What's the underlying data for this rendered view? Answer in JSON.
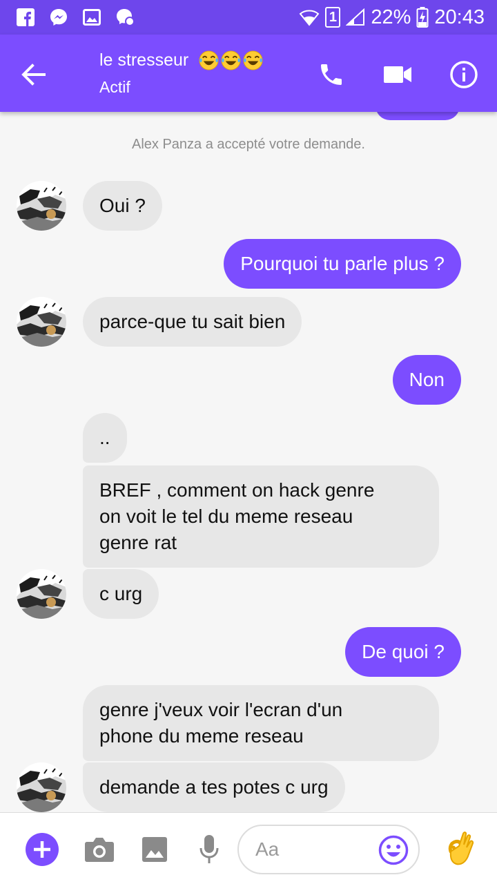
{
  "status_bar": {
    "left_icons": [
      "facebook-icon",
      "messenger-icon",
      "gallery-icon",
      "messenger-bubble-icon"
    ],
    "sim": "1",
    "battery": "22%",
    "time": "20:43"
  },
  "header": {
    "contact_name": "le stresseur",
    "emoji_count": 3,
    "status": "Actif",
    "actions": [
      "phone-icon",
      "video-icon",
      "info-icon"
    ]
  },
  "conversation": {
    "system_message": "Alex Panza a accepté votre demande.",
    "messages": [
      {
        "from": "them",
        "text": "Oui ?"
      },
      {
        "from": "me",
        "text": "Pourquoi tu parle plus ?"
      },
      {
        "from": "them",
        "text": "parce-que tu sait bien"
      },
      {
        "from": "me",
        "text": "Non"
      },
      {
        "from": "them",
        "text": ".."
      },
      {
        "from": "them",
        "lines": [
          "BREF , comment on hack genre",
          "on voit le tel du meme reseau",
          "genre rat"
        ]
      },
      {
        "from": "them",
        "text": "c urg"
      },
      {
        "from": "me",
        "text": "De quoi ?"
      },
      {
        "from": "them",
        "lines": [
          "genre j'veux voir l'ecran d'un",
          "phone du meme reseau"
        ]
      },
      {
        "from": "them",
        "text": "demande a tes potes c urg"
      }
    ]
  },
  "composer": {
    "placeholder": "Aa",
    "buttons": [
      "plus-icon",
      "camera-icon",
      "image-icon",
      "microphone-icon",
      "smiley-icon",
      "ok-hand-icon"
    ]
  },
  "colors": {
    "accent": "#7c4dff",
    "status_bar": "#6e46ec",
    "incoming_bubble": "#e7e7e7"
  }
}
